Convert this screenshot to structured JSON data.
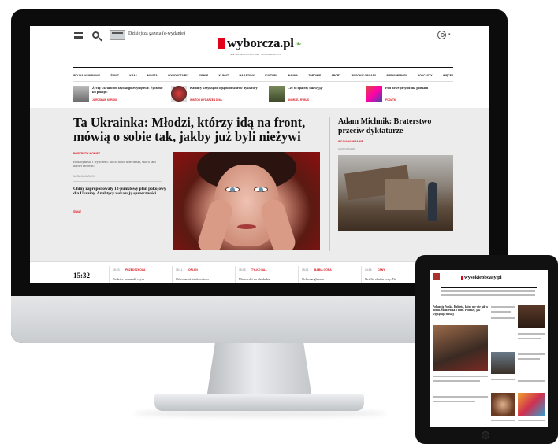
{
  "header": {
    "paper_link": "Dzisiejsza gazeta (e-wydanie)",
    "logo": "wyborcza.pl",
    "tagline": "NIE MA WOLNOŚCI BEZ SOLIDARNOŚCI"
  },
  "nav": [
    "WOJNA W UKRAINIE",
    "ŚWIAT",
    "KRAJ",
    "MIASTA",
    "WYBORCZA.BIZ",
    "OPINIE",
    "KLIMAT",
    "MAGAZYNY",
    "KULTURA",
    "NAUKA",
    "ZDROWIE",
    "SPORT",
    "WYSOKIE OBCASY",
    "PRENUMERATA",
    "PODCASTY",
    "WIĘCEJ"
  ],
  "teasers": [
    {
      "title": "Życzę Ukraińcom szybkiego zwycięstwa! Życzenie ku pokoju!",
      "author": "JAROSŁAW KURSKI"
    },
    {
      "title": "Katolicy krzyczą do oglądu obszarów dyktatury",
      "author": "WIKTOR WYDARZEŃ DNIA"
    },
    {
      "title": "Czy to opatrzy tak wyją?",
      "author": "ANDRZEJ RYBUS"
    },
    {
      "title": "Pod nowe przyłóż dla polskich",
      "author": "PODATKI"
    }
  ],
  "main": {
    "headline": "Ta Ukrainka: Młodzi, którzy idą na front, mówią o sobie tak, jakby już byli nieżywi",
    "kicker": "PORTRETY KOBIET",
    "lead": "Bodabym się i wyliczem: po co robić sołecheski, skoro tam kobiet ratować?",
    "lead_author": "NATALIA MAZUCH",
    "second_title": "Chiny zaproponowały 12-punktowy plan pokojowy dla Ukrainy. Analitycy wskazują sprzeczności",
    "second_tag": "ŚWIAT"
  },
  "side": {
    "title": "Adam Michnik: Braterstwo przeciw dyktaturze",
    "tag": "WOJNA W UKRAINIE",
    "author": "ADAM MICHNIK"
  },
  "ticker": {
    "clock": "15:32",
    "items": [
      {
        "time": "15:23",
        "category": "PRZEDSZKOLA",
        "text": "Rodzice pokazali, czym"
      },
      {
        "time": "15:11",
        "category": "ORLEN",
        "text": "Orlen na oświadczeniom"
      },
      {
        "time": "15:05",
        "category": "TYLKO NA...",
        "text": "Makowski na chodniku"
      },
      {
        "time": "15:01",
        "category": "BABIA GÓRA",
        "text": "Ochrona gleasca"
      },
      {
        "time": "14:56",
        "category": "CENY",
        "text": "Netflix obniża ceny. Na"
      }
    ]
  },
  "tablet": {
    "logo": "wysokieobcasy.pl",
    "headline": "Pokazuję Polskę. Kobieta, która nie wie jak w domu. Mała Polka o mieć. Podróże, jak wyglądają dzisiaj"
  }
}
